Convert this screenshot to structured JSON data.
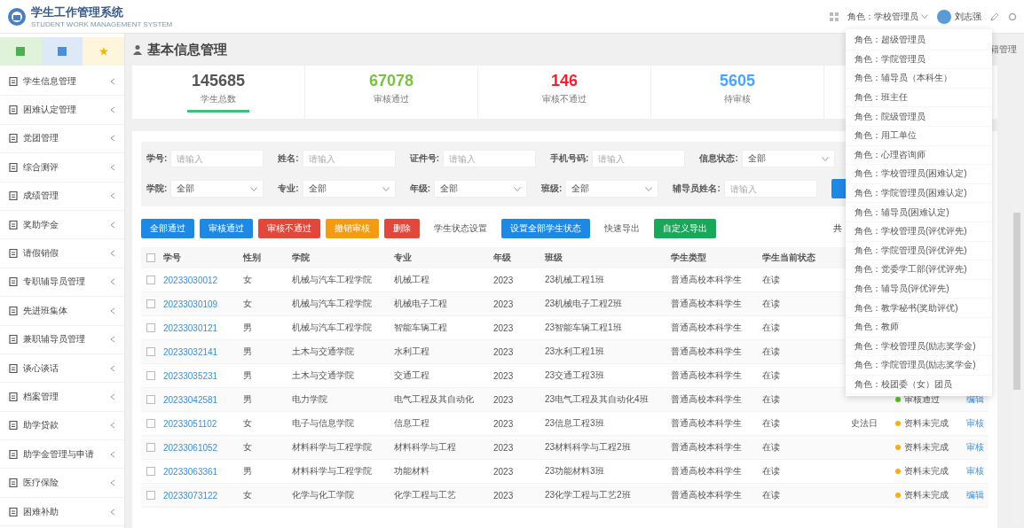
{
  "header": {
    "title": "学生工作管理系统",
    "subtitle": "STUDENT WORK MANAGEMENT SYSTEM",
    "role": "角色：学校管理员",
    "user": "刘志强"
  },
  "sidebar": {
    "items": [
      {
        "label": "学生信息管理"
      },
      {
        "label": "困难认定管理"
      },
      {
        "label": "党团管理"
      },
      {
        "label": "综合测评"
      },
      {
        "label": "成绩管理"
      },
      {
        "label": "奖助学金"
      },
      {
        "label": "请假销假"
      },
      {
        "label": "专职辅导员管理"
      },
      {
        "label": "先进班集体"
      },
      {
        "label": "兼职辅导员管理"
      },
      {
        "label": "谈心谈话"
      },
      {
        "label": "档案管理"
      },
      {
        "label": "助学贷款"
      },
      {
        "label": "助学金管理与申请"
      },
      {
        "label": "医疗保险"
      },
      {
        "label": "困难补助"
      }
    ]
  },
  "page": {
    "title": "基本信息管理",
    "side_text": "籍管理"
  },
  "stats": [
    {
      "value": "145685",
      "label": "学生总数",
      "color": "#555555",
      "selected": true
    },
    {
      "value": "67078",
      "label": "审核通过",
      "color": "#7ac143",
      "selected": false
    },
    {
      "value": "146",
      "label": "审核不通过",
      "color": "#f5222d",
      "selected": false
    },
    {
      "value": "5605",
      "label": "待审核",
      "color": "#4aa3ff",
      "selected": false
    }
  ],
  "filters": [
    [
      {
        "kind": "input",
        "label": "学号:",
        "placeholder": "请输入"
      },
      {
        "kind": "input",
        "label": "姓名:",
        "placeholder": "请输入"
      },
      {
        "kind": "input",
        "label": "证件号:",
        "placeholder": "请输入"
      },
      {
        "kind": "input",
        "label": "手机号码:",
        "placeholder": "请输入"
      },
      {
        "kind": "select",
        "label": "信息状态:",
        "value": "全部"
      }
    ],
    [
      {
        "kind": "select",
        "label": "学院:",
        "value": "全部"
      },
      {
        "kind": "select",
        "label": "专业:",
        "value": "全部"
      },
      {
        "kind": "select",
        "label": "年级:",
        "value": "全部"
      },
      {
        "kind": "select",
        "label": "班级:",
        "value": "全部"
      },
      {
        "kind": "input",
        "label": "辅导员姓名:",
        "placeholder": "请输入"
      },
      {
        "kind": "button"
      }
    ]
  ],
  "actions": [
    {
      "kind": "primary",
      "label": "全部通过"
    },
    {
      "kind": "primary",
      "label": "审核通过"
    },
    {
      "kind": "danger",
      "label": "审核不通过"
    },
    {
      "kind": "warning",
      "label": "撤销审核"
    },
    {
      "kind": "danger",
      "label": "删除"
    },
    {
      "kind": "plain",
      "label": "学生状态设置"
    },
    {
      "kind": "primary",
      "label": "设置全部学生状态"
    },
    {
      "kind": "plain",
      "label": "快速导出"
    },
    {
      "kind": "success",
      "label": "自定义导出"
    }
  ],
  "pagination_text": "共",
  "table": {
    "all_checked": false,
    "columns": [
      "学号",
      "性别",
      "学院",
      "专业",
      "年级",
      "班级",
      "学生类型",
      "学生当前状态"
    ],
    "rows": [
      {
        "checked": false,
        "student_id": "20233030012",
        "gender": "女",
        "college": "机械与汽车工程学院",
        "major": "机械工程",
        "grade": "2023",
        "class": "23机械工程1班",
        "type": "普通高校本科学生",
        "state": "在读"
      },
      {
        "checked": false,
        "student_id": "20233030109",
        "gender": "女",
        "college": "机械与汽车工程学院",
        "major": "机械电子工程",
        "grade": "2023",
        "class": "23机械电子工程2班",
        "type": "普通高校本科学生",
        "state": "在读"
      },
      {
        "checked": false,
        "student_id": "20233030121",
        "gender": "男",
        "college": "机械与汽车工程学院",
        "major": "智能车辆工程",
        "grade": "2023",
        "class": "23智能车辆工程1班",
        "type": "普通高校本科学生",
        "state": "在读"
      },
      {
        "checked": false,
        "student_id": "20233032141",
        "gender": "男",
        "college": "土木与交通学院",
        "major": "水利工程",
        "grade": "2023",
        "class": "23水利工程1班",
        "type": "普通高校本科学生",
        "state": "在读"
      },
      {
        "checked": false,
        "student_id": "20233035231",
        "gender": "男",
        "college": "土木与交通学院",
        "major": "交通工程",
        "grade": "2023",
        "class": "23交通工程3班",
        "type": "普通高校本科学生",
        "state": "在读"
      },
      {
        "checked": false,
        "student_id": "20233042581",
        "gender": "男",
        "college": "电力学院",
        "major": "电气工程及其自动化",
        "grade": "2023",
        "class": "23电气工程及其自动化4班",
        "type": "普通高校本科学生",
        "state": "在读",
        "status": {
          "label": "审核通过",
          "color": "#52c41a"
        },
        "action": "编辑"
      },
      {
        "checked": false,
        "student_id": "20233051102",
        "gender": "女",
        "college": "电子与信息学院",
        "major": "信息工程",
        "grade": "2023",
        "class": "23信息工程3班",
        "type": "普通高校本科学生",
        "state": "在读",
        "column_10": "史法日",
        "status": {
          "label": "资料未完成",
          "color": "#faad14"
        },
        "action": "审核"
      },
      {
        "checked": false,
        "student_id": "20233061052",
        "gender": "女",
        "college": "材料科学与工程学院",
        "major": "材料科学与工程",
        "grade": "2023",
        "class": "23材料科学与工程2班",
        "type": "普通高校本科学生",
        "state": "在读",
        "status": {
          "label": "资料未完成",
          "color": "#faad14"
        },
        "action": "审核"
      },
      {
        "checked": false,
        "student_id": "20233063361",
        "gender": "男",
        "college": "材料科学与工程学院",
        "major": "功能材料",
        "grade": "2023",
        "class": "23功能材料3班",
        "type": "普通高校本科学生",
        "state": "在读",
        "status": {
          "label": "资料未完成",
          "color": "#faad14"
        },
        "action": "审核"
      },
      {
        "checked": false,
        "student_id": "20233073122",
        "gender": "女",
        "college": "化学与化工学院",
        "major": "化学工程与工艺",
        "grade": "2023",
        "class": "23化学工程与工艺2班",
        "type": "普通高校本科学生",
        "state": "在读",
        "status": {
          "label": "资料未完成",
          "color": "#faad14"
        },
        "action": "编辑"
      }
    ]
  },
  "role_menu": [
    "角色：超级管理员",
    "角色：学院管理员",
    "角色：辅导员（本科生）",
    "角色：班主任",
    "角色：院级管理员",
    "角色：用工单位",
    "角色：心理咨询师",
    "角色：学校管理员(困难认定)",
    "角色：学院管理员(困难认定)",
    "角色：辅导员(困难认定)",
    "角色：学校管理员(评优评先)",
    "角色：学院管理员(评优评先)",
    "角色：党委学工部(评优评先)",
    "角色：辅导员(评优评先)",
    "角色：教学秘书(奖助评优)",
    "角色：教师",
    "角色：学校管理员(励志奖学金)",
    "角色：学院管理员(励志奖学金)",
    "角色：校团委（女）团员"
  ]
}
